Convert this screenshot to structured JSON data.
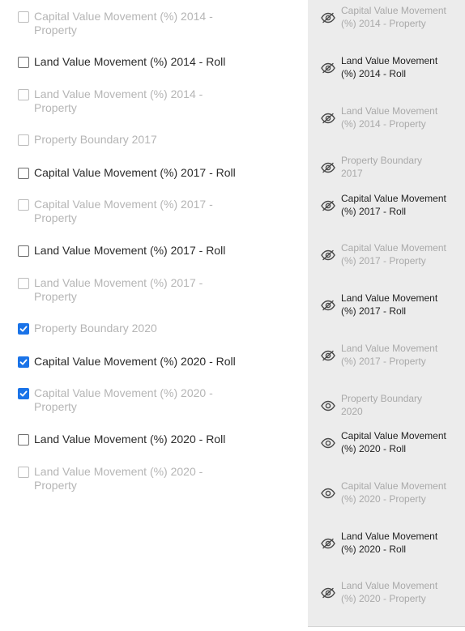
{
  "checklist": [
    {
      "label": "Capital Value Movement (%) 2014 - Property",
      "checked": false,
      "muted": true
    },
    {
      "label": "Land Value Movement (%) 2014 - Roll",
      "checked": false,
      "muted": false
    },
    {
      "label": "Land Value Movement (%) 2014 - Property",
      "checked": false,
      "muted": true
    },
    {
      "label": "Property Boundary 2017",
      "checked": false,
      "muted": true
    },
    {
      "label": "Capital Value Movement (%) 2017 - Roll",
      "checked": false,
      "muted": false
    },
    {
      "label": "Capital Value Movement (%) 2017 - Property",
      "checked": false,
      "muted": true
    },
    {
      "label": "Land Value Movement (%) 2017 - Roll",
      "checked": false,
      "muted": false
    },
    {
      "label": "Land Value Movement (%) 2017 - Property",
      "checked": false,
      "muted": true
    },
    {
      "label": "Property Boundary 2020",
      "checked": true,
      "muted": true
    },
    {
      "label": "Capital Value Movement (%) 2020 - Roll",
      "checked": true,
      "muted": false
    },
    {
      "label": "Capital Value Movement (%) 2020 - Property",
      "checked": true,
      "muted": true
    },
    {
      "label": "Land Value Movement (%) 2020 - Roll",
      "checked": false,
      "muted": false
    },
    {
      "label": "Land Value Movement (%) 2020 - Property",
      "checked": false,
      "muted": true
    }
  ],
  "layers": [
    {
      "label": "Capital Value Movement (%) 2014 - Property",
      "icon": "eye-off-icon",
      "muted": true
    },
    {
      "label": "Land Value Movement (%) 2014 - Roll",
      "icon": "eye-off-icon",
      "muted": false
    },
    {
      "label": "Land Value Movement (%) 2014 - Property",
      "icon": "eye-off-icon",
      "muted": true
    },
    {
      "label": "Property Boundary 2017",
      "icon": "eye-off-icon",
      "muted": true
    },
    {
      "label": "Capital Value Movement (%) 2017 - Roll",
      "icon": "eye-off-icon",
      "muted": false
    },
    {
      "label": "Capital Value Movement (%) 2017 - Property",
      "icon": "eye-off-icon",
      "muted": true
    },
    {
      "label": "Land Value Movement (%) 2017 - Roll",
      "icon": "eye-off-icon",
      "muted": false
    },
    {
      "label": "Land Value Movement (%) 2017 - Property",
      "icon": "eye-off-icon",
      "muted": true
    },
    {
      "label": "Property Boundary 2020",
      "icon": "eye-icon",
      "muted": true
    },
    {
      "label": "Capital Value Movement (%) 2020 - Roll",
      "icon": "eye-icon",
      "muted": false
    },
    {
      "label": "Capital Value Movement (%) 2020 - Property",
      "icon": "eye-icon",
      "muted": true
    },
    {
      "label": "Land Value Movement (%) 2020 - Roll",
      "icon": "eye-off-icon",
      "muted": false
    },
    {
      "label": "Land Value Movement (%) 2020 - Property",
      "icon": "eye-off-icon",
      "muted": true
    }
  ],
  "colors": {
    "accent": "#1a73e8",
    "text": "#2b2b2b",
    "muted_text": "#b5b5b5",
    "panel_bg": "#ececec"
  }
}
